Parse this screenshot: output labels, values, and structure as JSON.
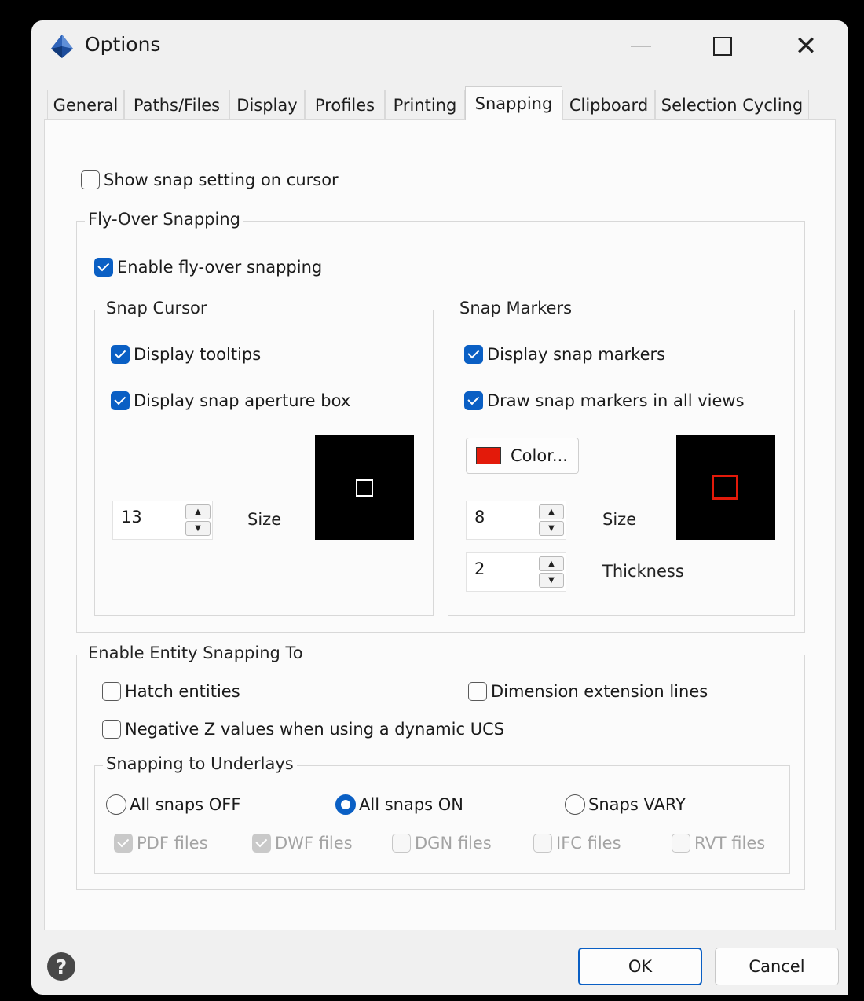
{
  "window": {
    "title": "Options"
  },
  "tabs": [
    {
      "label": "General"
    },
    {
      "label": "Paths/Files"
    },
    {
      "label": "Display"
    },
    {
      "label": "Profiles"
    },
    {
      "label": "Printing"
    },
    {
      "label": "Snapping",
      "active": true
    },
    {
      "label": "Clipboard"
    },
    {
      "label": "Selection Cycling"
    }
  ],
  "snapping": {
    "show_snap_setting": {
      "label": "Show snap setting on cursor",
      "checked": false
    },
    "flyover": {
      "legend": "Fly-Over Snapping",
      "enable": {
        "label": "Enable fly-over snapping",
        "checked": true
      },
      "snap_cursor": {
        "legend": "Snap Cursor",
        "display_tooltips": {
          "label": "Display tooltips",
          "checked": true
        },
        "display_aperture": {
          "label": "Display snap aperture box",
          "checked": true
        },
        "size_value": "13",
        "size_label": "Size"
      },
      "snap_markers": {
        "legend": "Snap Markers",
        "display_markers": {
          "label": "Display snap markers",
          "checked": true
        },
        "draw_all_views": {
          "label": "Draw snap markers in all views",
          "checked": true
        },
        "color_button": "Color...",
        "marker_color": "#e31a0a",
        "size_value": "8",
        "size_label": "Size",
        "thickness_value": "2",
        "thickness_label": "Thickness"
      }
    },
    "entity": {
      "legend": "Enable Entity Snapping To",
      "hatch": {
        "label": "Hatch entities",
        "checked": false
      },
      "dimension": {
        "label": "Dimension extension lines",
        "checked": false
      },
      "negative_z": {
        "label": "Negative Z values when using a dynamic UCS",
        "checked": false
      },
      "underlays": {
        "legend": "Snapping to Underlays",
        "radios": [
          {
            "label": "All snaps OFF",
            "selected": false
          },
          {
            "label": "All snaps ON",
            "selected": true
          },
          {
            "label": "Snaps VARY",
            "selected": false
          }
        ],
        "files": [
          {
            "label": "PDF files",
            "checked": true
          },
          {
            "label": "DWF files",
            "checked": true
          },
          {
            "label": "DGN files",
            "checked": false
          },
          {
            "label": "IFC files",
            "checked": false
          },
          {
            "label": "RVT files",
            "checked": false
          }
        ]
      }
    }
  },
  "footer": {
    "ok": "OK",
    "cancel": "Cancel"
  },
  "colors": {
    "accent": "#0a5fc4",
    "marker": "#e31a0a"
  }
}
